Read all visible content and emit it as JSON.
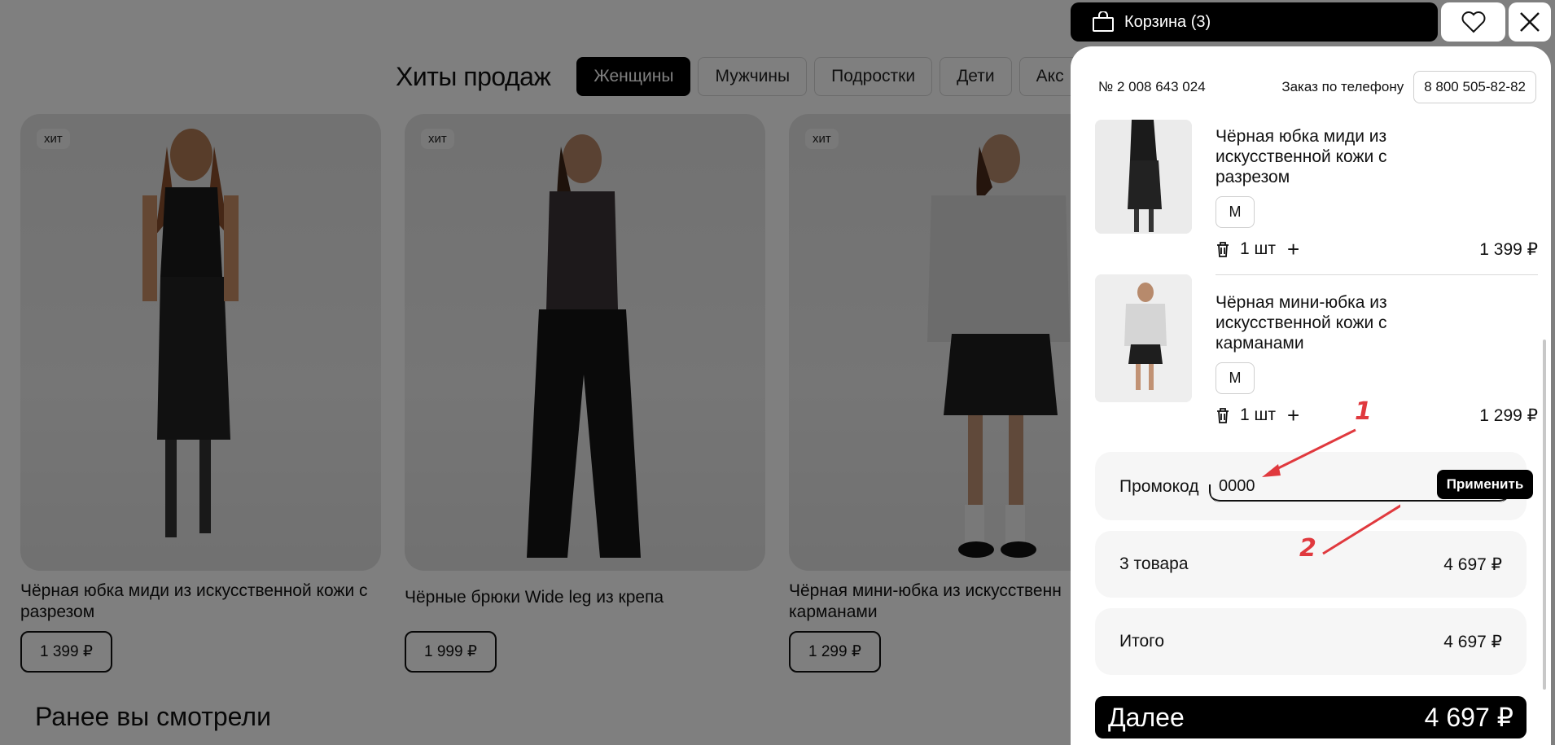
{
  "page": {
    "hits_title": "Хиты продаж",
    "category_tabs": [
      "Женщины",
      "Мужчины",
      "Подростки",
      "Дети",
      "Акс"
    ],
    "active_tab": "Женщины",
    "products": [
      {
        "badge": "хит",
        "name": "Чёрная юбка миди из искусственной кожи с разрезом",
        "price": "1 399 ₽"
      },
      {
        "badge": "хит",
        "name": "Чёрные брюки Wide leg из крепа",
        "price": "1 999 ₽"
      },
      {
        "badge": "хит",
        "name": "Чёрная мини-юбка из искусственн карманами",
        "price": "1 299 ₽"
      }
    ],
    "recent_title": "Ранее вы смотрели"
  },
  "topbar": {
    "cart_label": "Корзина (3)",
    "icons": {
      "cart": "shopping-bag-icon",
      "favorites": "heart-icon",
      "close": "close-icon"
    }
  },
  "drawer": {
    "order_number": "№ 2 008 643 024",
    "phone_label": "Заказ по телефону",
    "phone_number": "8 800 505-82-82",
    "items": [
      {
        "title": "Чёрная юбка миди из искусственной кожи с разрезом",
        "size": "M",
        "qty": "1 шт",
        "price": "1 399 ₽"
      },
      {
        "title": "Чёрная мини-юбка из искусственной кожи с карманами",
        "size": "M",
        "qty": "1 шт",
        "price": "1 299 ₽"
      }
    ],
    "promo": {
      "label": "Промокод",
      "value": "0000",
      "apply": "Применить"
    },
    "count_label": "3 товара",
    "count_value": "4 697 ₽",
    "total_label": "Итого",
    "total_value": "4 697 ₽",
    "next_label": "Далее",
    "next_value": "4 697 ₽"
  },
  "annotations": {
    "marker_1": "1",
    "marker_2": "2",
    "color": "#e0393e"
  }
}
